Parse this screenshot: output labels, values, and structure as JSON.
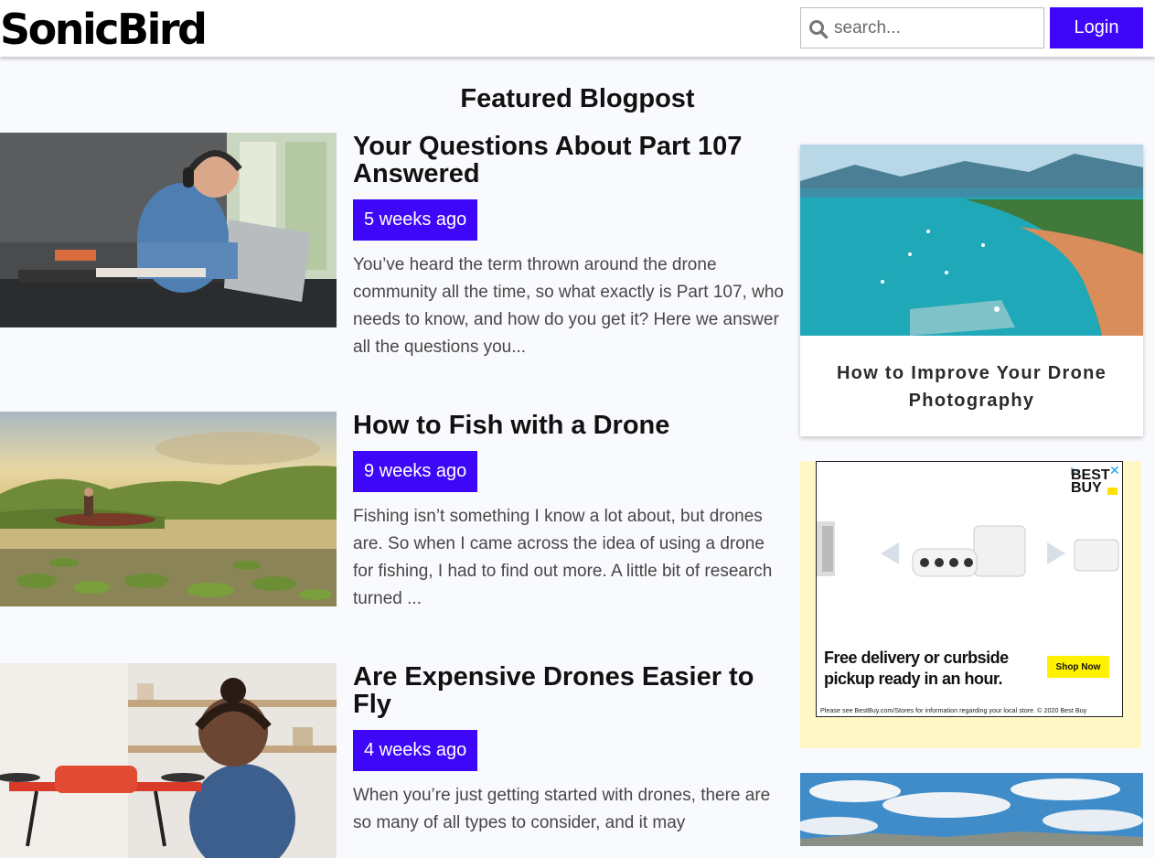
{
  "header": {
    "logo": "SonicBird",
    "search_placeholder": "search...",
    "search_icon": "search-icon",
    "login_label": "Login"
  },
  "featured_heading": "Featured Blogpost",
  "posts": [
    {
      "title": "Your Questions About Part 107 Answered",
      "date": "5 weeks ago",
      "excerpt": "You’ve heard the term thrown around the drone community all the time, so what exactly is Part 107, who needs to know, and how do you get it? Here we answer all the questions you..."
    },
    {
      "title": "How to Fish with a Drone",
      "date": "9 weeks ago",
      "excerpt": "Fishing isn’t something I know a lot about, but drones are. So when I came across the idea of using a drone for fishing, I had to find out more. A little bit of research turned ..."
    },
    {
      "title": "Are Expensive Drones Easier to Fly",
      "date": "4 weeks ago",
      "excerpt": "When you’re just getting started with drones, there are so many of all types to consider, and it may"
    }
  ],
  "sidebar": {
    "card_title": "How to Improve Your Drone Photography",
    "ad": {
      "brand": "BEST BUY",
      "headline": "Free delivery or curbside pickup ready in an hour.",
      "cta": "Shop Now",
      "fine_print": "Please see BestBuy.com/Stores for information regarding your local store. © 2020 Best Buy",
      "adchoices_icon": "adchoices-icon",
      "close_icon": "close-icon"
    }
  },
  "colors": {
    "accent": "#3e07f7",
    "page_bg": "#f9fafd",
    "ad_bg": "#fff8c6"
  }
}
